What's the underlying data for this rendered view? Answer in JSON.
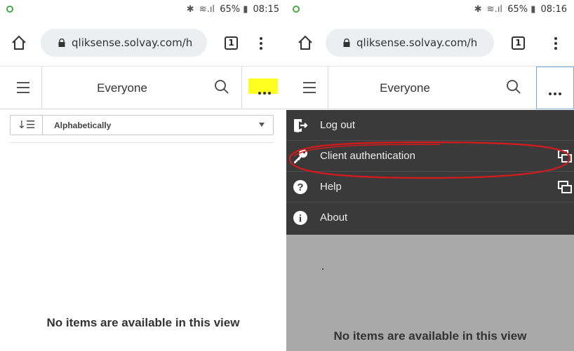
{
  "left_screen": {
    "status": {
      "right_text": "65%",
      "time": "08:15"
    },
    "browser": {
      "url": "qliksense.solvay.com/h",
      "tab_count": "1"
    },
    "app_bar": {
      "title": "Everyone"
    },
    "sort": {
      "label": "Alphabetically"
    },
    "empty_message": "No items are available in this view"
  },
  "right_screen": {
    "status": {
      "right_text": "65%",
      "time": "08:16"
    },
    "browser": {
      "url": "qliksense.solvay.com/h",
      "tab_count": "1"
    },
    "app_bar": {
      "title": "Everyone"
    },
    "menu": {
      "items": [
        {
          "label": "Log out",
          "icon": "logout-icon",
          "external": false
        },
        {
          "label": "Client authentication",
          "icon": "key-icon",
          "external": true
        },
        {
          "label": "Help",
          "icon": "help-icon",
          "external": true
        },
        {
          "label": "About",
          "icon": "info-icon",
          "external": false
        }
      ]
    },
    "empty_message": "No items are available in this view"
  },
  "colors": {
    "highlight": "#ffff20",
    "annotation": "#d41a1a",
    "menu_background": "#3a3a3a",
    "overlay": "#a9a9a9",
    "status_ok": "#46a846"
  }
}
